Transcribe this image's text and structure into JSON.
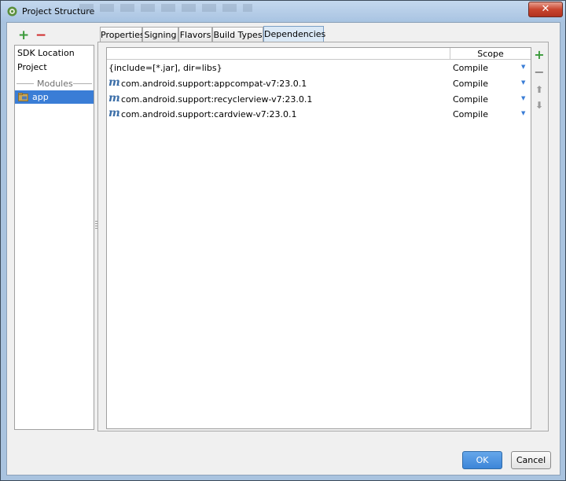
{
  "window": {
    "title": "Project Structure",
    "close_label": "✕"
  },
  "left_toolbar": {
    "add_label": "+",
    "remove_label": "−"
  },
  "left_panel": {
    "items": [
      {
        "label": "SDK Location"
      },
      {
        "label": "Project"
      }
    ],
    "modules_header": "Modules",
    "modules": [
      {
        "label": "app",
        "selected": true,
        "icon": "module-folder-icon"
      }
    ]
  },
  "tabs": [
    {
      "label": "Properties"
    },
    {
      "label": "Signing"
    },
    {
      "label": "Flavors"
    },
    {
      "label": "Build Types"
    },
    {
      "label": "Dependencies",
      "active": true
    }
  ],
  "dependencies": {
    "columns": {
      "name": "",
      "scope": "Scope"
    },
    "rows": [
      {
        "name": "{include=[*.jar], dir=libs}",
        "scope": "Compile",
        "maven_icon": false
      },
      {
        "name": "com.android.support:appcompat-v7:23.0.1",
        "scope": "Compile",
        "maven_icon": true
      },
      {
        "name": "com.android.support:recyclerview-v7:23.0.1",
        "scope": "Compile",
        "maven_icon": true
      },
      {
        "name": "com.android.support:cardview-v7:23.0.1",
        "scope": "Compile",
        "maven_icon": true
      }
    ],
    "maven_icon_glyph": "m",
    "dropdown_glyph": "▼"
  },
  "side_toolbar": {
    "add_label": "+",
    "remove_label": "−",
    "up_label": "⬆",
    "down_label": "⬇"
  },
  "buttons": {
    "ok_label": "OK",
    "cancel_label": "Cancel"
  },
  "colors": {
    "selection": "#3a7dd6",
    "add_green": "#3a9a3a",
    "remove_red": "#d02828",
    "maven_blue": "#3b6ea8",
    "ok_button": "#4a90e2"
  }
}
